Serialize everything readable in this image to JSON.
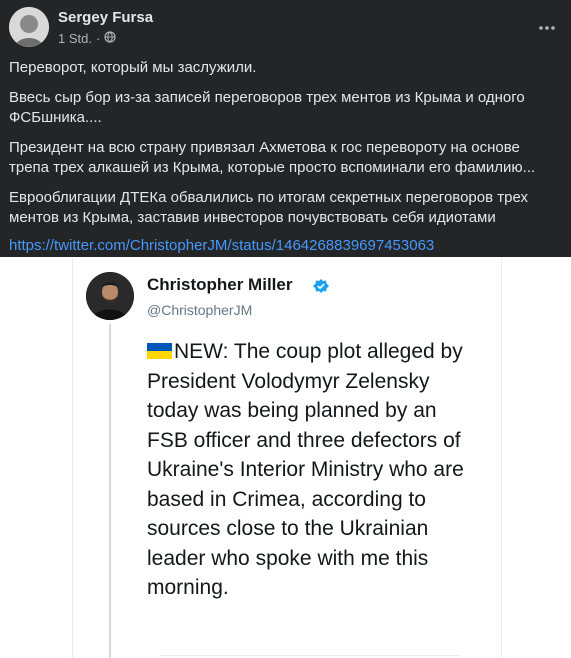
{
  "post": {
    "author": "Sergey Fursa",
    "time": "1 Std.",
    "separator": "·",
    "paragraphs": [
      "Переворот, который мы заслужили.",
      "Ввесь сыр бор из-за записей переговоров трех ментов из Крыма и одного ФСБшника....",
      "Президент на всю страну привязал Ахметова к гос перевороту на основе трепа трех алкашей из Крыма, которые просто вспоминали его фамилию...",
      "Еврооблигации ДТЕКа обвалились по итогам секретных переговоров трех ментов из Крыма, заставив инвесторов почувствовать себя идиотами"
    ],
    "link": "https://twitter.com/ChristopherJM/status/1464268839697453063"
  },
  "tweet": {
    "name": "Christopher Miller",
    "handle": "@ChristopherJM",
    "text": "NEW: The coup plot alleged by President Volodymyr Zelensky today was being planned by an FSB officer and three defectors of Ukraine's Interior Ministry who are based in Crimea, according to sources close to the Ukrainian leader who spoke with me this morning."
  },
  "colors": {
    "post_bg": "#242526",
    "link": "#4599ff",
    "verified": "#1da1f2",
    "flag_blue": "#0057b7",
    "flag_yellow": "#ffd700"
  },
  "icons": [
    "globe-icon",
    "more-icon",
    "verified-icon",
    "ukraine-flag-icon"
  ]
}
